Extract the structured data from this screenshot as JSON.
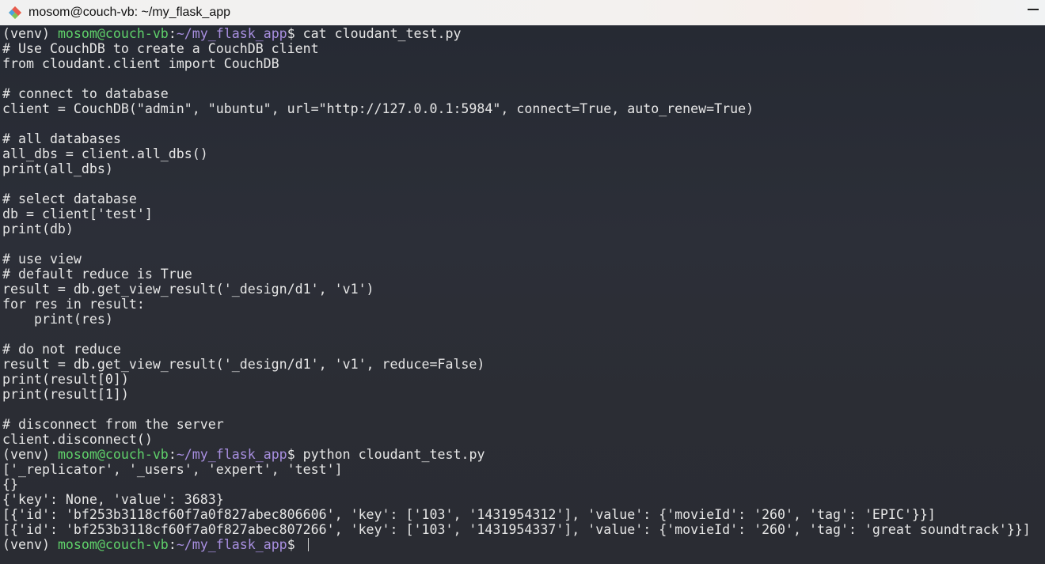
{
  "window": {
    "title": "mosom@couch-vb: ~/my_flask_app"
  },
  "prompt": {
    "venv": "(venv) ",
    "user_host": "mosom@couch-vb",
    "sep": ":",
    "path": "~/my_flask_app",
    "symbol": "$ "
  },
  "colors": {
    "user_host": "#5fd16a",
    "path": "#a88fe0",
    "text": "#e6e6e6",
    "background": "#2a2d36"
  },
  "lines": [
    {
      "type": "prompt",
      "cmd": "cat cloudant_test.py"
    },
    {
      "type": "text",
      "text": "# Use CouchDB to create a CouchDB client"
    },
    {
      "type": "text",
      "text": "from cloudant.client import CouchDB"
    },
    {
      "type": "text",
      "text": ""
    },
    {
      "type": "text",
      "text": "# connect to database"
    },
    {
      "type": "text",
      "text": "client = CouchDB(\"admin\", \"ubuntu\", url=\"http://127.0.0.1:5984\", connect=True, auto_renew=True)"
    },
    {
      "type": "text",
      "text": ""
    },
    {
      "type": "text",
      "text": "# all databases"
    },
    {
      "type": "text",
      "text": "all_dbs = client.all_dbs()"
    },
    {
      "type": "text",
      "text": "print(all_dbs)"
    },
    {
      "type": "text",
      "text": ""
    },
    {
      "type": "text",
      "text": "# select database"
    },
    {
      "type": "text",
      "text": "db = client['test']"
    },
    {
      "type": "text",
      "text": "print(db)"
    },
    {
      "type": "text",
      "text": ""
    },
    {
      "type": "text",
      "text": "# use view"
    },
    {
      "type": "text",
      "text": "# default reduce is True"
    },
    {
      "type": "text",
      "text": "result = db.get_view_result('_design/d1', 'v1')"
    },
    {
      "type": "text",
      "text": "for res in result:"
    },
    {
      "type": "text",
      "text": "    print(res)"
    },
    {
      "type": "text",
      "text": ""
    },
    {
      "type": "text",
      "text": "# do not reduce"
    },
    {
      "type": "text",
      "text": "result = db.get_view_result('_design/d1', 'v1', reduce=False)"
    },
    {
      "type": "text",
      "text": "print(result[0])"
    },
    {
      "type": "text",
      "text": "print(result[1])"
    },
    {
      "type": "text",
      "text": ""
    },
    {
      "type": "text",
      "text": "# disconnect from the server"
    },
    {
      "type": "text",
      "text": "client.disconnect()"
    },
    {
      "type": "prompt",
      "cmd": "python cloudant_test.py"
    },
    {
      "type": "text",
      "text": "['_replicator', '_users', 'expert', 'test']"
    },
    {
      "type": "text",
      "text": "{}"
    },
    {
      "type": "text",
      "text": "{'key': None, 'value': 3683}"
    },
    {
      "type": "text",
      "text": "[{'id': 'bf253b3118cf60f7a0f827abec806606', 'key': ['103', '1431954312'], 'value': {'movieId': '260', 'tag': 'EPIC'}}]"
    },
    {
      "type": "text",
      "text": "[{'id': 'bf253b3118cf60f7a0f827abec807266', 'key': ['103', '1431954337'], 'value': {'movieId': '260', 'tag': 'great soundtrack'}}]"
    },
    {
      "type": "prompt",
      "cmd": "",
      "cursor": true
    }
  ]
}
